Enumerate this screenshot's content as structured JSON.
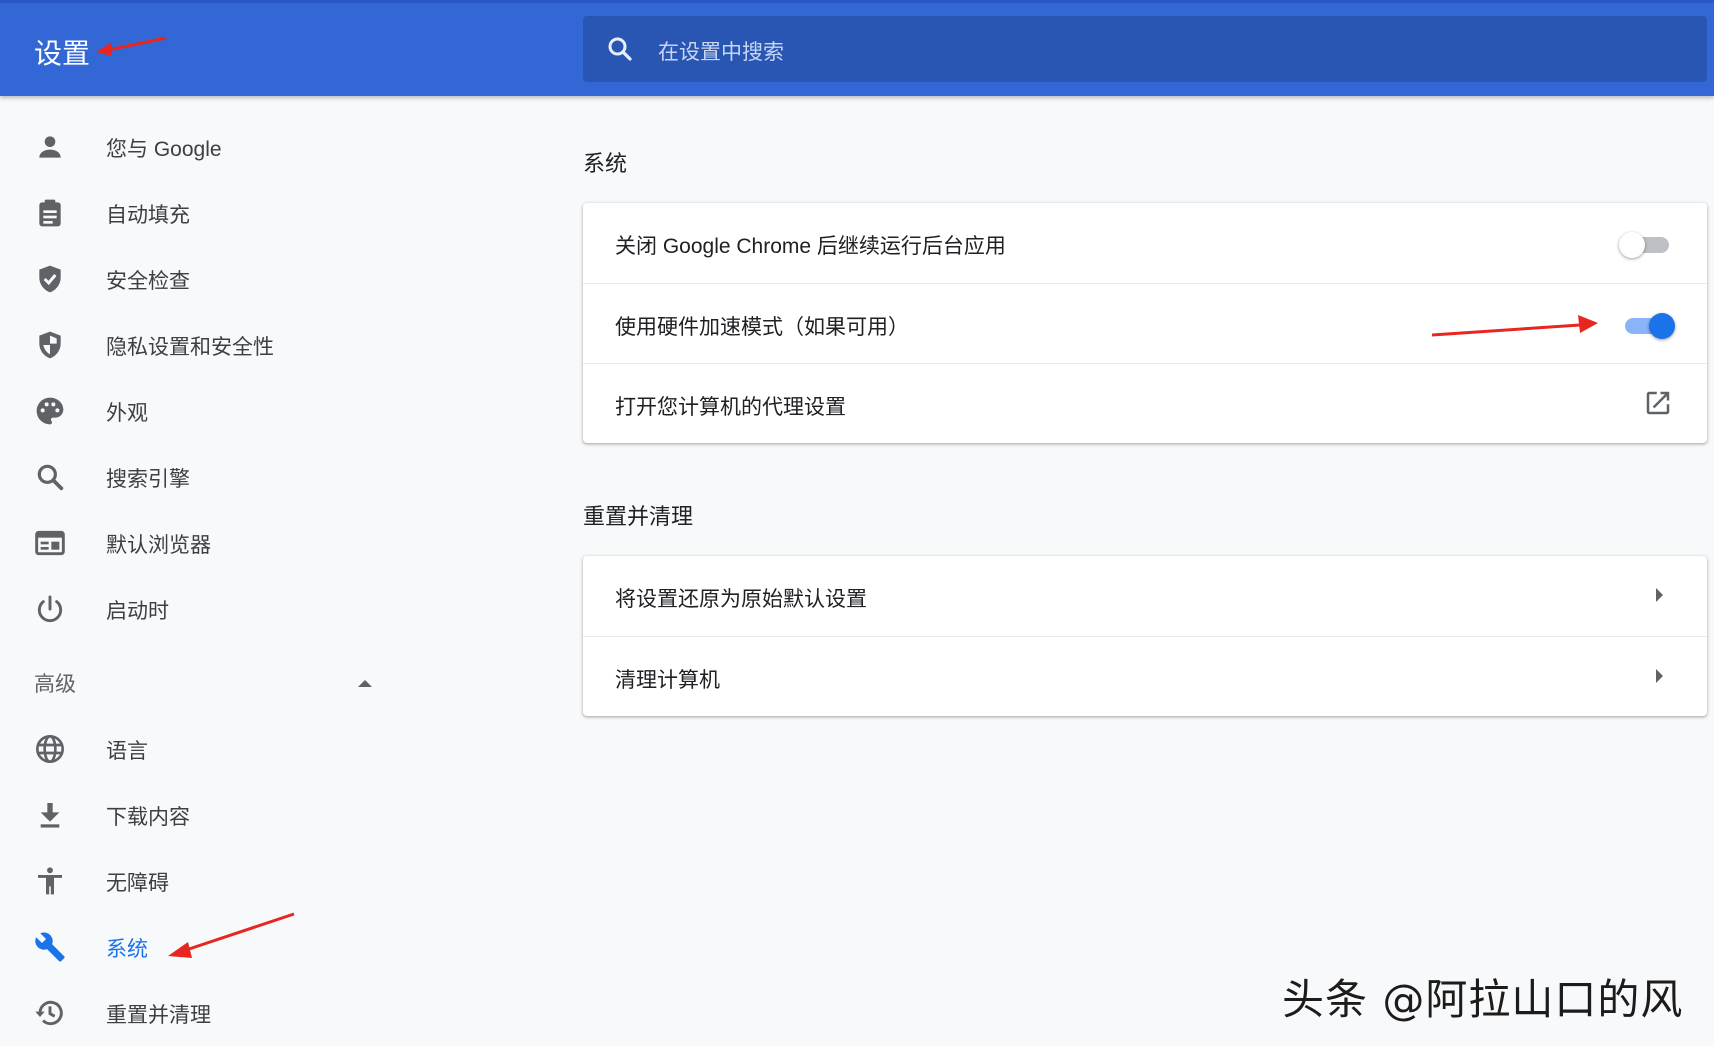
{
  "header": {
    "title": "设置",
    "search_placeholder": "在设置中搜索"
  },
  "sidebar": {
    "items": [
      {
        "label": "您与 Google",
        "icon": "person-icon"
      },
      {
        "label": "自动填充",
        "icon": "clipboard-icon"
      },
      {
        "label": "安全检查",
        "icon": "shield-check-icon"
      },
      {
        "label": "隐私设置和安全性",
        "icon": "shield-half-icon"
      },
      {
        "label": "外观",
        "icon": "palette-icon"
      },
      {
        "label": "搜索引擎",
        "icon": "search-icon"
      },
      {
        "label": "默认浏览器",
        "icon": "browser-window-icon"
      },
      {
        "label": "启动时",
        "icon": "power-icon"
      }
    ],
    "advanced_label": "高级",
    "advanced_items": [
      {
        "label": "语言",
        "icon": "globe-icon"
      },
      {
        "label": "下载内容",
        "icon": "download-icon"
      },
      {
        "label": "无障碍",
        "icon": "accessibility-icon"
      },
      {
        "label": "系统",
        "icon": "wrench-icon",
        "active": true
      },
      {
        "label": "重置并清理",
        "icon": "history-icon"
      }
    ]
  },
  "main": {
    "system_section": {
      "title": "系统",
      "rows": [
        {
          "label": "关闭 Google Chrome 后继续运行后台应用",
          "control": "toggle",
          "checked": false
        },
        {
          "label": "使用硬件加速模式（如果可用）",
          "control": "toggle",
          "checked": true
        },
        {
          "label": "打开您计算机的代理设置",
          "control": "external-link-icon"
        }
      ]
    },
    "reset_section": {
      "title": "重置并清理",
      "rows": [
        {
          "label": "将设置还原为原始默认设置",
          "control": "arrow-right-icon"
        },
        {
          "label": "清理计算机",
          "control": "arrow-right-icon"
        }
      ]
    }
  },
  "watermark": "头条 @阿拉山口的风",
  "colors": {
    "header_bg": "#3367d6",
    "accent": "#1a73e8",
    "annotation_arrow": "#e8261f"
  }
}
